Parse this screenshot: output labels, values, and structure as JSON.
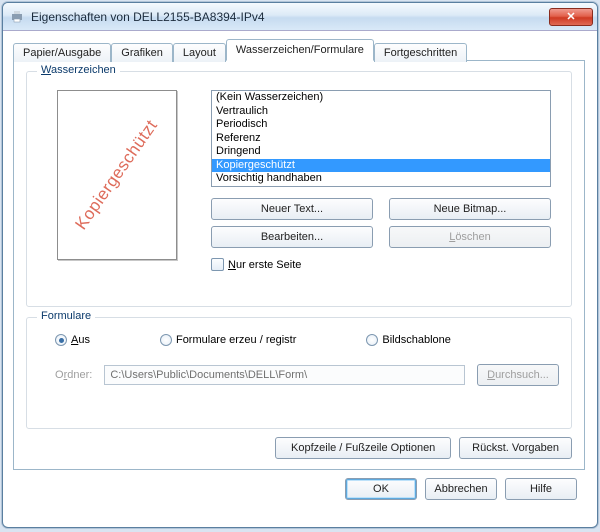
{
  "window": {
    "title": "Eigenschaften von DELL2155-BA8394-IPv4"
  },
  "tabs": {
    "paper": "Papier/Ausgabe",
    "graphics": "Grafiken",
    "layout": "Layout",
    "watermark": "Wasserzeichen/Formulare",
    "advanced": "Fortgeschritten"
  },
  "watermark": {
    "legend": "Wasserzeichen",
    "preview_text": "Kopiergeschützt",
    "options": [
      "(Kein Wasserzeichen)",
      "Vertraulich",
      "Periodisch",
      "Referenz",
      "Dringend",
      "Kopiergeschützt",
      "Vorsichtig handhaben"
    ],
    "selected_index": 5,
    "btn_new_text": "Neuer Text...",
    "btn_new_bitmap": "Neue Bitmap...",
    "btn_edit": "Bearbeiten...",
    "btn_delete": "Löschen",
    "first_page_only": "Nur erste Seite"
  },
  "forms": {
    "legend": "Formulare",
    "radio_off": "Aus",
    "radio_create": "Formulare erzeu / registr",
    "radio_overlay": "Bildschablone",
    "selected": "off",
    "folder_label": "Ordner:",
    "folder_path": "C:\\Users\\Public\\Documents\\DELL\\Form\\",
    "browse": "Durchsuch..."
  },
  "page_buttons": {
    "header_footer": "Kopfzeile / Fußzeile Optionen",
    "restore_defaults": "Rückst. Vorgaben"
  },
  "dialog_buttons": {
    "ok": "OK",
    "cancel": "Abbrechen",
    "help": "Hilfe"
  }
}
